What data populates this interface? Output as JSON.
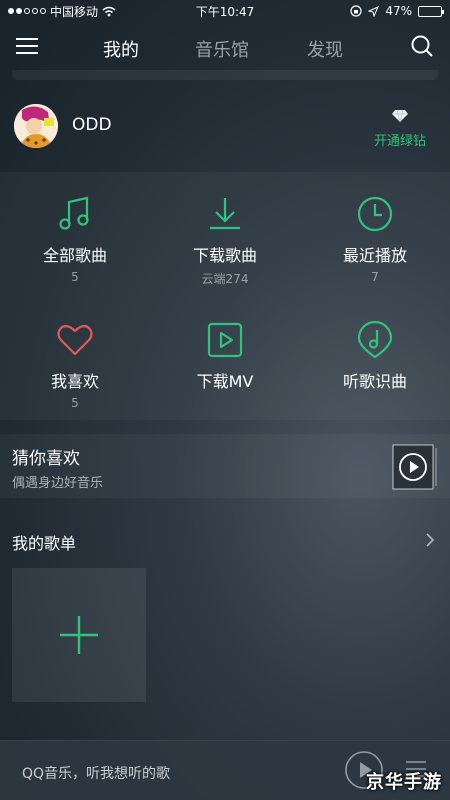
{
  "status_bar": {
    "carrier": "中国移动",
    "time": "下午10:47",
    "battery": "47%",
    "battery_level": 0.47,
    "signal_dots_filled": 2,
    "signal_dots_total": 5
  },
  "nav": {
    "tabs": [
      {
        "label": "我的",
        "active": true
      },
      {
        "label": "音乐馆",
        "active": false
      },
      {
        "label": "发现",
        "active": false
      }
    ],
    "menu_icon": "hamburger-icon",
    "search_icon": "search-icon"
  },
  "profile": {
    "username": "ODD",
    "vip_label": "开通绿钻",
    "vip_icon": "diamond-icon"
  },
  "grid": [
    {
      "label": "全部歌曲",
      "sub": "5",
      "icon": "music-note-icon"
    },
    {
      "label": "下载歌曲",
      "sub": "云端274",
      "icon": "download-icon"
    },
    {
      "label": "最近播放",
      "sub": "7",
      "icon": "clock-icon"
    },
    {
      "label": "我喜欢",
      "sub": "5",
      "icon": "heart-icon"
    },
    {
      "label": "下载MV",
      "sub": "",
      "icon": "video-play-icon"
    },
    {
      "label": "听歌识曲",
      "sub": "",
      "icon": "music-recognition-icon"
    }
  ],
  "guess": {
    "title": "猜你喜欢",
    "subtitle": "偶遇身边好音乐"
  },
  "playlists": {
    "title": "我的歌单"
  },
  "player": {
    "text": "QQ音乐，听我想听的歌"
  },
  "watermark": "京华手游",
  "colors": {
    "accent_green": "#31c27c",
    "heart_red": "#e05a5a"
  }
}
